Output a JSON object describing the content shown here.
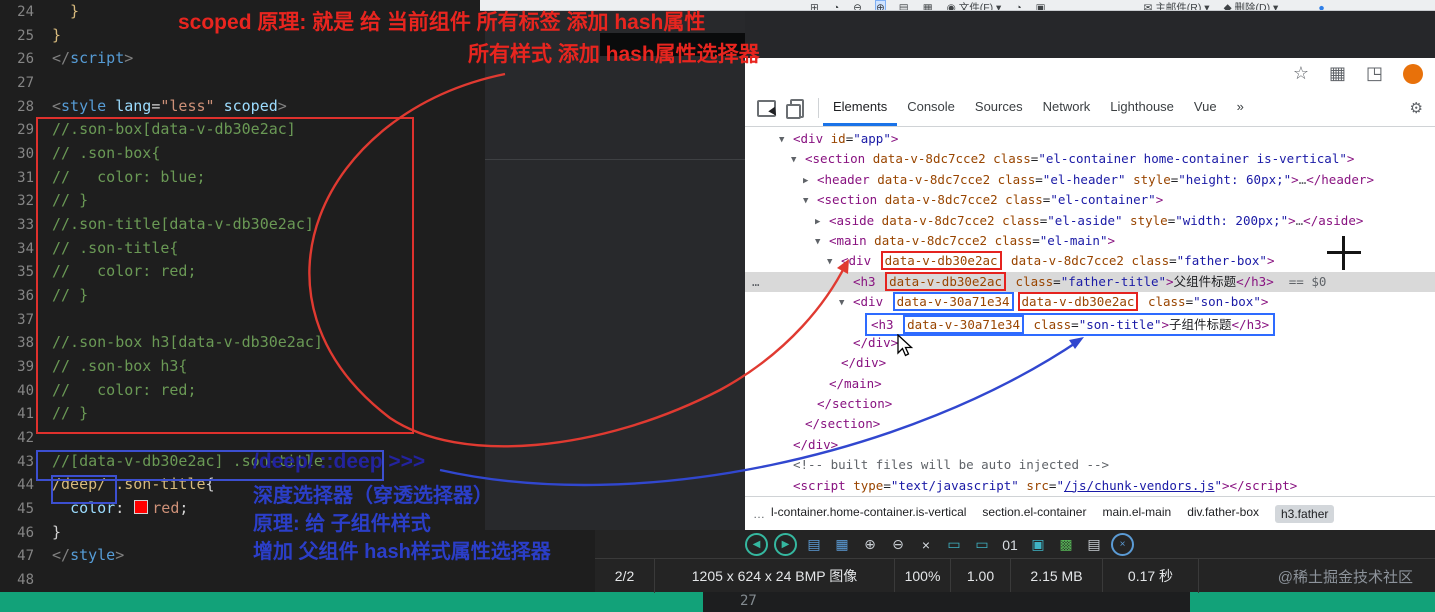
{
  "viewer": {
    "top_toolbar": {
      "items": [
        {
          "name": "pan-tool",
          "glyph": "⊞"
        },
        {
          "name": "rotate-tool",
          "glyph": "◔"
        },
        {
          "name": "zoom-out-tool",
          "glyph": "⊖"
        },
        {
          "name": "zoom-in-tool",
          "glyph": "⊕",
          "active": true
        },
        {
          "name": "view-list-tool",
          "glyph": "▤"
        },
        {
          "name": "view-grid-tool",
          "glyph": "▦"
        },
        {
          "name": "file-menu",
          "glyph": "◉",
          "label": "文件(F)",
          "caret": "▾"
        },
        {
          "name": "effects-tool",
          "glyph": "◔"
        },
        {
          "name": "screen-tool",
          "glyph": "▣"
        },
        {
          "name": "mail-menu",
          "glyph": "✉",
          "label": "主邮件(R)",
          "caret": "▾"
        },
        {
          "name": "delete-menu",
          "glyph": "◆",
          "label": "删除(D)",
          "caret": "▾"
        },
        {
          "name": "app-button",
          "glyph": "●",
          "color": "#2f7fe8"
        }
      ]
    },
    "icons": [
      {
        "name": "prev-image",
        "glyph": "◀",
        "color": "#35b8a0",
        "circle": true
      },
      {
        "name": "next-image",
        "glyph": "▶",
        "color": "#35b8a0",
        "circle": true
      },
      {
        "name": "browse-list",
        "glyph": "▤",
        "color": "#5b9bd5"
      },
      {
        "name": "thumbnail-grid",
        "glyph": "▦",
        "color": "#5b9bd5"
      },
      {
        "name": "zoom-in",
        "glyph": "⊕",
        "color": "#c8cdd2"
      },
      {
        "name": "zoom-out",
        "glyph": "⊖",
        "color": "#c8cdd2"
      },
      {
        "name": "close-image",
        "glyph": "×",
        "color": "#d8dde2"
      },
      {
        "name": "fit-width",
        "glyph": "▭",
        "color": "#3fb3c4"
      },
      {
        "name": "fit-window",
        "glyph": "▭",
        "color": "#3fb3c4"
      },
      {
        "name": "actual-size",
        "glyph": "01",
        "color": "#d8dde2"
      },
      {
        "name": "fullscreen",
        "glyph": "▣",
        "color": "#3fb3c4"
      },
      {
        "name": "slideshow",
        "glyph": "▩",
        "color": "#57b757"
      },
      {
        "name": "print",
        "glyph": "▤",
        "color": "#c8cdd2"
      },
      {
        "name": "settings",
        "glyph": "×",
        "color": "#5b9bd5",
        "circle": true
      }
    ],
    "status_cells": [
      "2/2",
      "1205 x 624 x 24 BMP 图像",
      "100%",
      "1.00",
      "2.15 MB",
      "0.17 秒"
    ],
    "watermark": "@稀土掘金技术社区"
  },
  "editor": {
    "lines": [
      {
        "n": 24,
        "tk": [
          [
            "y",
            "  }"
          ]
        ]
      },
      {
        "n": 25,
        "tk": [
          [
            "y",
            "}"
          ]
        ]
      },
      {
        "n": 26,
        "tk": [
          [
            "p",
            "</"
          ],
          [
            "t",
            "script"
          ],
          [
            "p",
            ">"
          ]
        ]
      },
      {
        "n": 27,
        "tk": []
      },
      {
        "n": 28,
        "tk": [
          [
            "p",
            "<"
          ],
          [
            "t",
            "style"
          ],
          [
            "a",
            " lang"
          ],
          [
            "w",
            "="
          ],
          [
            "s",
            "\"less\""
          ],
          [
            "a",
            " scoped"
          ],
          [
            "p",
            ">"
          ]
        ]
      },
      {
        "n": 29,
        "tk": [
          [
            "c",
            "//.son-box[data-v-db30e2ac]"
          ]
        ]
      },
      {
        "n": 30,
        "tk": [
          [
            "c",
            "// .son-box{"
          ]
        ]
      },
      {
        "n": 31,
        "tk": [
          [
            "c",
            "//   color: blue;"
          ]
        ]
      },
      {
        "n": 32,
        "tk": [
          [
            "c",
            "// }"
          ]
        ]
      },
      {
        "n": 33,
        "tk": [
          [
            "c",
            "//.son-title[data-v-db30e2ac]"
          ]
        ]
      },
      {
        "n": 34,
        "tk": [
          [
            "c",
            "// .son-title{"
          ]
        ]
      },
      {
        "n": 35,
        "tk": [
          [
            "c",
            "//   color: red;"
          ]
        ]
      },
      {
        "n": 36,
        "tk": [
          [
            "c",
            "// }"
          ]
        ]
      },
      {
        "n": 37,
        "tk": []
      },
      {
        "n": 38,
        "tk": [
          [
            "c",
            "//.son-box h3[data-v-db30e2ac]"
          ]
        ]
      },
      {
        "n": 39,
        "tk": [
          [
            "c",
            "// .son-box h3{"
          ]
        ]
      },
      {
        "n": 40,
        "tk": [
          [
            "c",
            "//   color: red;"
          ]
        ]
      },
      {
        "n": 41,
        "tk": [
          [
            "c",
            "// }"
          ]
        ]
      },
      {
        "n": 42,
        "tk": []
      },
      {
        "n": 43,
        "tk": [
          [
            "c",
            "//[data-v-db30e2ac] .son-title"
          ]
        ]
      },
      {
        "n": 44,
        "tk": [
          [
            "y",
            "/deep/ .son-title"
          ],
          [
            "w",
            "{"
          ]
        ]
      },
      {
        "n": 45,
        "tk": [
          [
            "w",
            "  "
          ],
          [
            "a",
            "color"
          ],
          [
            "w",
            ": "
          ],
          [
            "sw",
            ""
          ],
          [
            "s",
            "red"
          ],
          [
            "w",
            ";"
          ]
        ]
      },
      {
        "n": 46,
        "tk": [
          [
            "w",
            "}"
          ]
        ]
      },
      {
        "n": 47,
        "tk": [
          [
            "p",
            "</"
          ],
          [
            "t",
            "style"
          ],
          [
            "p",
            ">"
          ]
        ]
      },
      {
        "n": 48,
        "tk": []
      }
    ]
  },
  "annotations": {
    "red_line1": "scoped 原理: 就是 给 当前组件 所有标签 添加 hash属性",
    "red_line2": "所有样式 添加 hash属性选择器",
    "blue_line1": "/deep/  ::deep   >>>",
    "blue_line2": "深度选择器（穿透选择器）",
    "blue_line3": "原理: 给 子组件样式",
    "blue_line4": "增加 父组件 hash样式属性选择器"
  },
  "browser": {
    "actions": [
      {
        "name": "bookmark-star-icon",
        "glyph": "☆"
      },
      {
        "name": "apps-grid-icon",
        "glyph": "▦"
      },
      {
        "name": "extensions-icon",
        "glyph": "◳"
      },
      {
        "name": "profile-avatar",
        "glyph": "●"
      }
    ]
  },
  "devtools": {
    "tabs": [
      {
        "label": "Elements",
        "active": true
      },
      {
        "label": "Console"
      },
      {
        "label": "Sources"
      },
      {
        "label": "Network"
      },
      {
        "label": "Lighthouse"
      },
      {
        "label": "Vue"
      },
      {
        "label": "»"
      }
    ],
    "settings_gear": "⚙",
    "dom": [
      {
        "i": 0,
        "ar": "v",
        "tk": [
          [
            "t",
            "<div"
          ],
          [
            "a",
            " id"
          ],
          [
            "x",
            "="
          ],
          [
            "v",
            "\"app\""
          ],
          [
            "t",
            ">"
          ]
        ]
      },
      {
        "i": 1,
        "ar": "v",
        "tk": [
          [
            "t",
            "<section"
          ],
          [
            "a",
            " data-v-8dc7cce2"
          ],
          [
            "a",
            " class"
          ],
          [
            "x",
            "="
          ],
          [
            "v",
            "\"el-container home-container is-vertical\""
          ],
          [
            "t",
            ">"
          ]
        ]
      },
      {
        "i": 2,
        "ar": "r",
        "tk": [
          [
            "t",
            "<header"
          ],
          [
            "a",
            " data-v-8dc7cce2"
          ],
          [
            "a",
            " class"
          ],
          [
            "x",
            "="
          ],
          [
            "v",
            "\"el-header\""
          ],
          [
            "a",
            " style"
          ],
          [
            "x",
            "="
          ],
          [
            "v",
            "\"height: 60px;\""
          ],
          [
            "t",
            ">"
          ],
          [
            "g",
            "…"
          ],
          [
            "t",
            "</header>"
          ]
        ]
      },
      {
        "i": 2,
        "ar": "v",
        "tk": [
          [
            "t",
            "<section"
          ],
          [
            "a",
            " data-v-8dc7cce2"
          ],
          [
            "a",
            " class"
          ],
          [
            "x",
            "="
          ],
          [
            "v",
            "\"el-container\""
          ],
          [
            "t",
            ">"
          ]
        ]
      },
      {
        "i": 3,
        "ar": "r",
        "tk": [
          [
            "t",
            "<aside"
          ],
          [
            "a",
            " data-v-8dc7cce2"
          ],
          [
            "a",
            " class"
          ],
          [
            "x",
            "="
          ],
          [
            "v",
            "\"el-aside\""
          ],
          [
            "a",
            " style"
          ],
          [
            "x",
            "="
          ],
          [
            "v",
            "\"width: 200px;\""
          ],
          [
            "t",
            ">"
          ],
          [
            "g",
            "…"
          ],
          [
            "t",
            "</aside>"
          ]
        ]
      },
      {
        "i": 3,
        "ar": "v",
        "tk": [
          [
            "t",
            "<main"
          ],
          [
            "a",
            " data-v-8dc7cce2"
          ],
          [
            "a",
            " class"
          ],
          [
            "x",
            "="
          ],
          [
            "v",
            "\"el-main\""
          ],
          [
            "t",
            ">"
          ]
        ]
      },
      {
        "i": 4,
        "ar": "v",
        "tk": [
          [
            "t",
            "<div "
          ],
          [
            "a",
            "data-v-db30e2ac",
            "r"
          ],
          [
            "a",
            " data-v-8dc7cce2"
          ],
          [
            "a",
            " class"
          ],
          [
            "x",
            "="
          ],
          [
            "v",
            "\"father-box\""
          ],
          [
            "t",
            ">"
          ]
        ]
      },
      {
        "i": 5,
        "ar": null,
        "hl": true,
        "ld": true,
        "tk": [
          [
            "t",
            "<h3 "
          ],
          [
            "a",
            "data-v-db30e2ac",
            "r"
          ],
          [
            "a",
            " class"
          ],
          [
            "x",
            "="
          ],
          [
            "v",
            "\"father-title\""
          ],
          [
            "t",
            ">"
          ],
          [
            "x",
            "父组件标题"
          ],
          [
            "t",
            "</h3>"
          ],
          [
            "g",
            "  == $0"
          ]
        ]
      },
      {
        "i": 5,
        "ar": "v",
        "tk": [
          [
            "t",
            "<div "
          ],
          [
            "a",
            "data-v-30a71e34",
            "b"
          ],
          [
            "a",
            "data-v-db30e2ac",
            "r"
          ],
          [
            "a",
            " class"
          ],
          [
            "x",
            "="
          ],
          [
            "v",
            "\"son-box\""
          ],
          [
            "t",
            ">"
          ]
        ]
      },
      {
        "i": 6,
        "ar": null,
        "rb": true,
        "tk": [
          [
            "t",
            "<h3 "
          ],
          [
            "a",
            "data-v-30a71e34",
            "b"
          ],
          [
            "a",
            " class"
          ],
          [
            "x",
            "="
          ],
          [
            "v",
            "\"son-title\""
          ],
          [
            "t",
            ">"
          ],
          [
            "x",
            "子组件标题"
          ],
          [
            "t",
            "</h3>"
          ]
        ]
      },
      {
        "i": 5,
        "ar": null,
        "tk": [
          [
            "t",
            "</div>"
          ]
        ]
      },
      {
        "i": 4,
        "ar": null,
        "tk": [
          [
            "t",
            "</div>"
          ]
        ]
      },
      {
        "i": 3,
        "ar": null,
        "tk": [
          [
            "t",
            "</main>"
          ]
        ]
      },
      {
        "i": 2,
        "ar": null,
        "tk": [
          [
            "t",
            "</section>"
          ]
        ]
      },
      {
        "i": 1,
        "ar": null,
        "tk": [
          [
            "t",
            "</section>"
          ]
        ]
      },
      {
        "i": 0,
        "ar": null,
        "tk": [
          [
            "t",
            "</div>"
          ]
        ]
      },
      {
        "i": 0,
        "ar": null,
        "tk": [
          [
            "g",
            "<!-- built files will be auto injected -->"
          ]
        ]
      },
      {
        "i": 0,
        "ar": null,
        "tk": [
          [
            "t",
            "<script"
          ],
          [
            "a",
            " type"
          ],
          [
            "x",
            "="
          ],
          [
            "v",
            "\"text/javascript\""
          ],
          [
            "a",
            " src"
          ],
          [
            "x",
            "="
          ],
          [
            "v",
            "\""
          ],
          [
            "l",
            "/js/chunk-vendors.js"
          ],
          [
            "v",
            "\""
          ],
          [
            "t",
            "></script>"
          ]
        ]
      }
    ],
    "breadcrumb": {
      "ellipsis": "…",
      "items": [
        {
          "label": "l-container.home-container.is-vertical"
        },
        {
          "label": "section.el-container"
        },
        {
          "label": "main.el-main"
        },
        {
          "label": "div.father-box"
        },
        {
          "label": "h3.father",
          "active": true
        }
      ]
    }
  },
  "footer": {
    "line_number": "27"
  },
  "colors": {
    "annotation_red": "#e8251f",
    "annotation_blue": "#2b3ec8",
    "highlight_box_red": "#e5231f",
    "highlight_box_blue": "#2e6bff",
    "devtools_active_tab": "#1a73e8",
    "teal_bar": "#12a279",
    "avatar_orange": "#e8710a"
  }
}
